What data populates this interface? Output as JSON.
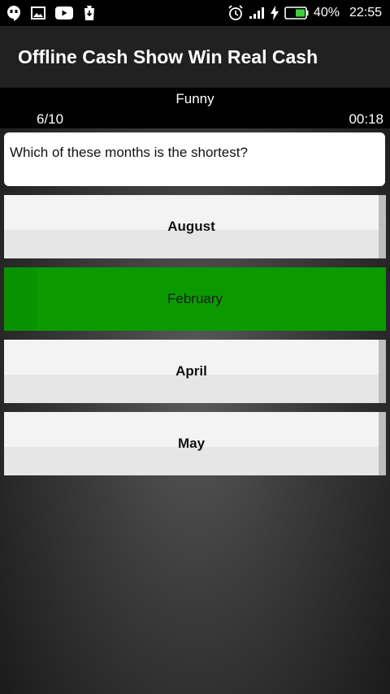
{
  "status_bar": {
    "battery": "40%",
    "time": "22:55"
  },
  "app_bar": {
    "title": "Offline Cash Show Win Real Cash"
  },
  "quiz": {
    "category": "Funny",
    "progress": "6/10",
    "timer": "00:18",
    "question": "Which of these months is the shortest?",
    "answers": [
      {
        "label": "August",
        "state": "normal"
      },
      {
        "label": "February",
        "state": "correct"
      },
      {
        "label": "April",
        "state": "normal"
      },
      {
        "label": "May",
        "state": "normal"
      }
    ]
  },
  "colors": {
    "correct_answer": "#0a9a00",
    "app_bar": "#212121",
    "status_bar": "#000000"
  },
  "icons": {
    "status_left": [
      "hangouts-icon",
      "gallery-icon",
      "youtube-icon",
      "download-icon"
    ],
    "status_right": [
      "alarm-icon",
      "signal-icon",
      "charging-icon",
      "battery-icon"
    ]
  }
}
